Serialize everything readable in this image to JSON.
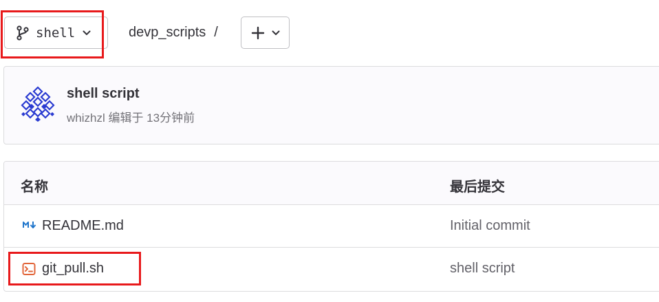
{
  "branch": {
    "name": "shell",
    "icon": "branch-icon"
  },
  "breadcrumb": {
    "project": "devp_scripts",
    "separator": "/"
  },
  "add_button": {
    "icon": "plus-icon"
  },
  "last_commit": {
    "title": "shell script",
    "author": "whizhzl",
    "meta_text": "whizhzl 编辑于 13分钟前"
  },
  "table": {
    "headers": {
      "name": "名称",
      "last_commit": "最后提交"
    },
    "rows": [
      {
        "name": "README.md",
        "icon": "markdown-icon",
        "commit": "Initial commit"
      },
      {
        "name": "git_pull.sh",
        "icon": "terminal-file-icon",
        "commit": "shell script"
      }
    ]
  },
  "colors": {
    "highlight": "#e8191b",
    "terminal_icon": "#e2653a",
    "markdown_icon": "#1f75cb"
  }
}
